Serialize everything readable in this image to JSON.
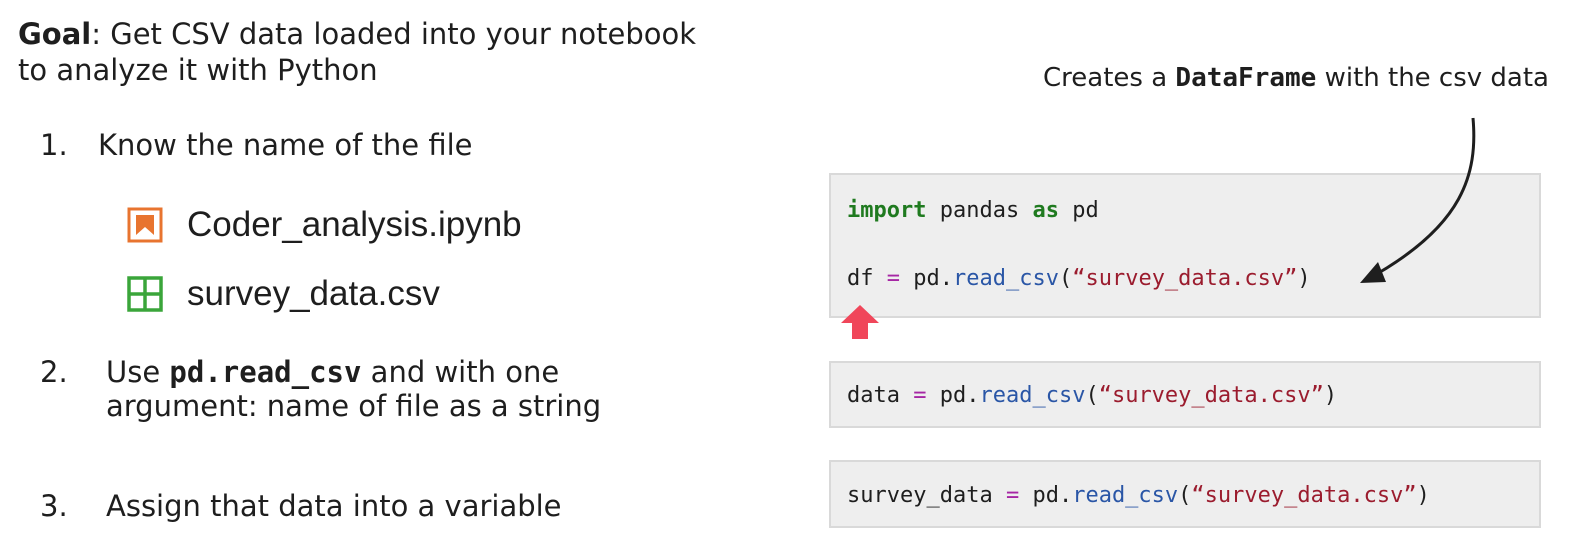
{
  "goal": {
    "label": "Goal",
    "line1": ": Get CSV data loaded into your notebook",
    "line2": "to analyze it with Python"
  },
  "steps": [
    {
      "num": "1.",
      "text": "Know the name of the file"
    },
    {
      "num": "2.",
      "text_before": "Use ",
      "code": "pd.read_csv",
      "text_after": " and with one",
      "text_line2": "argument: name of file as a string"
    },
    {
      "num": "3.",
      "text": "Assign that data into a variable"
    }
  ],
  "files": [
    {
      "name": "Coder_analysis.ipynb",
      "icon": "notebook-icon",
      "color": "#e8742f"
    },
    {
      "name": "survey_data.csv",
      "icon": "table-grid-icon",
      "color": "#3aa53a"
    }
  ],
  "annotation": {
    "before": "Creates a ",
    "code": "DataFrame",
    "after": " with the csv data"
  },
  "code_blocks": {
    "block1": {
      "line1": {
        "kw1": "import",
        "mid": " pandas ",
        "kw2": "as",
        "end": " pd"
      },
      "line2": {
        "var": "df",
        "eq": " = ",
        "obj": "pd.",
        "fn": "read_csv",
        "open": "(",
        "str": "“survey_data.csv”",
        "close": ")"
      }
    },
    "block2": {
      "var": "data",
      "eq": " = ",
      "obj": "pd.",
      "fn": "read_csv",
      "open": "(",
      "str": "“survey_data.csv”",
      "close": ")"
    },
    "block3": {
      "var": "survey_data",
      "eq": " = ",
      "obj": "pd.",
      "fn": "read_csv",
      "open": "(",
      "str": "“survey_data.csv”",
      "close": ")"
    }
  },
  "colors": {
    "keyword": "#1f7a1f",
    "operator": "#a626a4",
    "function": "#2a56a6",
    "string": "#9b1c2e",
    "up_arrow": "#f0465a",
    "code_bg": "#eeeeee"
  }
}
